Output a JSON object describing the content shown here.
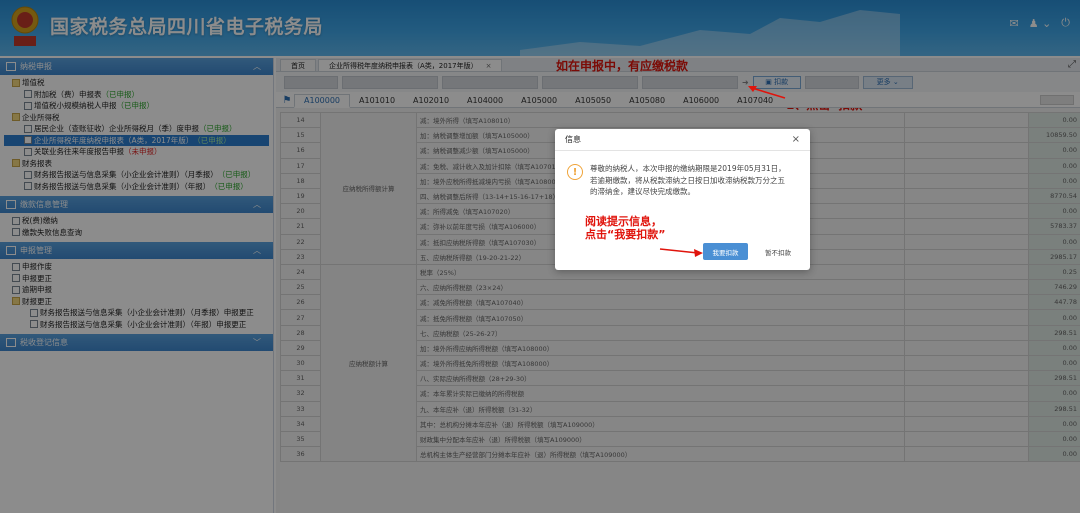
{
  "header": {
    "title": "国家税务总局四川省电子税务局"
  },
  "sidebar": {
    "sections": [
      {
        "label": "纳税申报"
      },
      {
        "label": "缴款信息管理"
      },
      {
        "label": "申报管理"
      },
      {
        "label": "税收登记信息"
      }
    ],
    "tax_items": [
      {
        "label": "增值税"
      },
      {
        "label": "附加税（费）申报表",
        "status": "（已申报）"
      },
      {
        "label": "增值税小规模纳税人申报",
        "status": "（已申报）"
      },
      {
        "label": "企业所得税"
      },
      {
        "label": "居民企业（查账征收）企业所得税月（季）度申报",
        "status": "（已申报）"
      },
      {
        "label": "企业所得税年度纳税申报表（A类，2017年版）",
        "status": "（已申报）"
      },
      {
        "label": "关联业务往来年度报告申报",
        "status": "（未申报）"
      },
      {
        "label": "财务报表"
      },
      {
        "label": "财务报告报送与信息采集（小企业会计准则）（月季报）",
        "status": "（已申报）"
      },
      {
        "label": "财务报告报送与信息采集（小企业会计准则）（年报）",
        "status": "（已申报）"
      }
    ],
    "payment_items": [
      {
        "label": "税(费)缴纳"
      },
      {
        "label": "缴款失败信息查询"
      }
    ],
    "manage_items": [
      {
        "label": "申报作废"
      },
      {
        "label": "申报更正"
      },
      {
        "label": "逾期申报"
      },
      {
        "label": "财报更正"
      },
      {
        "label": "财务报告报送与信息采集（小企业会计准则）（月季报）申报更正"
      },
      {
        "label": "财务报告报送与信息采集（小企业会计准则）（年报）申报更正"
      }
    ]
  },
  "tabs": [
    {
      "label": "首页"
    },
    {
      "label": "企业所得税年度纳税申报表（A类，2017年版）",
      "close": "×"
    }
  ],
  "toolbar": {
    "deduct_label": "扣款",
    "more_label": "更多 ⌄"
  },
  "form_tabs": [
    "A100000",
    "A101010",
    "A102010",
    "A104000",
    "A105000",
    "A105050",
    "A105080",
    "A106000",
    "A107040"
  ],
  "annotations": {
    "top": "如在申报中，有应缴税款",
    "click": "1、点击“扣款”",
    "read_1": "阅读提示信息，",
    "read_2": "点击“我要扣款”"
  },
  "table": {
    "group1": "应纳税所得额计算",
    "group2": "应纳税额计算",
    "rows": [
      {
        "no": "14",
        "item": "减：境外所得（填写A108010）",
        "amt": "0.00"
      },
      {
        "no": "15",
        "item": "加：纳税调整增加额（填写A105000）",
        "amt": "10859.50"
      },
      {
        "no": "16",
        "item": "减：纳税调整减少额（填写A105000）",
        "amt": "0.00"
      },
      {
        "no": "17",
        "item": "减：免税、减计收入及加计扣除（填写A107010）",
        "amt": "0.00"
      },
      {
        "no": "18",
        "item": "加：境外应税所得抵减境内亏损（填写A108000）",
        "amt": "0.00"
      },
      {
        "no": "19",
        "item": "四、纳税调整后所得（13-14+15-16-17+18）",
        "amt": "8770.54"
      },
      {
        "no": "20",
        "item": "减：所得减免（填写A107020）",
        "amt": "0.00"
      },
      {
        "no": "21",
        "item": "减：弥补以前年度亏损（填写A106000）",
        "amt": "5783.37"
      },
      {
        "no": "22",
        "item": "减：抵扣应纳税所得额（填写A107030）",
        "amt": "0.00"
      },
      {
        "no": "23",
        "item": "五、应纳税所得额（19-20-21-22）",
        "amt": "2985.17"
      },
      {
        "no": "24",
        "item": "税率（25%）",
        "amt": "0.25"
      },
      {
        "no": "25",
        "item": "六、应纳所得税额（23×24）",
        "amt": "746.29"
      },
      {
        "no": "26",
        "item": "减：减免所得税额（填写A107040）",
        "amt": "447.78"
      },
      {
        "no": "27",
        "item": "减：抵免所得税额（填写A107050）",
        "amt": "0.00"
      },
      {
        "no": "28",
        "item": "七、应纳税额（25-26-27）",
        "amt": "298.51"
      },
      {
        "no": "29",
        "item": "加：境外所得应纳所得税额（填写A108000）",
        "amt": "0.00"
      },
      {
        "no": "30",
        "item": "减：境外所得抵免所得税额（填写A108000）",
        "amt": "0.00"
      },
      {
        "no": "31",
        "item": "八、实际应纳所得税额（28+29-30）",
        "amt": "298.51"
      },
      {
        "no": "32",
        "item": "减：本年累计实际已缴纳的所得税额",
        "amt": "0.00"
      },
      {
        "no": "33",
        "item": "九、本年应补（退）所得税额（31-32）",
        "amt": "298.51"
      },
      {
        "no": "34",
        "item": "其中：总机构分摊本年应补（退）所得税额（填写A109000）",
        "amt": "0.00"
      },
      {
        "no": "35",
        "item": "财政集中分配本年应补（退）所得税额（填写A109000）",
        "amt": "0.00"
      },
      {
        "no": "36",
        "item": "总机构主体生产经营部门分摊本年应补（退）所得税额（填写A109000）",
        "amt": "0.00"
      }
    ]
  },
  "dialog": {
    "title": "信息",
    "close": "×",
    "message": "尊敬的纳税人，本次申报的缴纳期限是2019年05月31日，若逾期缴款，将从税款滞纳之日按日加收滞纳税款万分之五的滞纳金，建议尽快完成缴款。",
    "confirm_label": "我要扣款",
    "cancel_label": "暂不扣款"
  }
}
